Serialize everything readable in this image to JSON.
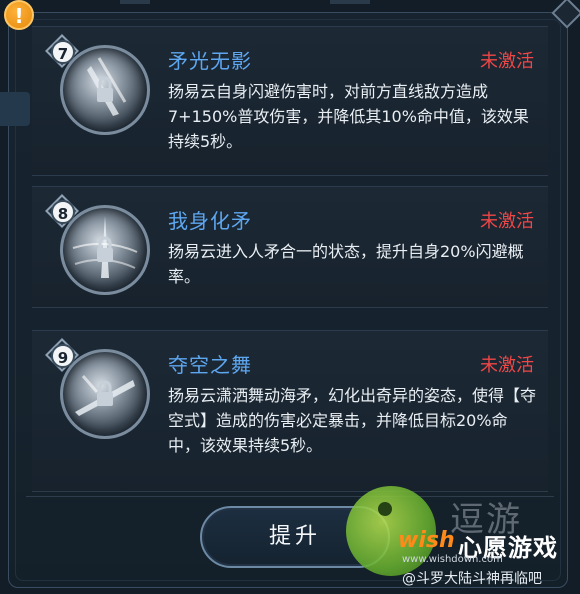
{
  "info_icon": "!",
  "skills": [
    {
      "number": "7",
      "title": "矛光无影",
      "status": "未激活",
      "description": "扬易云自身闪避伤害时，对前方直线敌方造成7+150%普攻伤害，并降低其10%命中值，该效果持续5秒。",
      "icon": "spear-lock-icon"
    },
    {
      "number": "8",
      "title": "我身化矛",
      "status": "未激活",
      "description": "扬易云进入人矛合一的状态，提升自身20%闪避概率。",
      "icon": "spear-lock-icon"
    },
    {
      "number": "9",
      "title": "夺空之舞",
      "status": "未激活",
      "description": "扬易云潇洒舞动海矛，幻化出奇异的姿态，使得【夺空式】造成的伤害必定暴击，并降低目标20%命中，该效果持续5秒。",
      "icon": "spear-lock-icon"
    }
  ],
  "upgrade_button": "提升",
  "watermark": {
    "gray_text": "逗游",
    "wish": "wish",
    "main": "心愿游戏",
    "url": "www.wishdown.com",
    "footer": "@斗罗大陆斗神再临吧"
  },
  "colors": {
    "title": "#5ea7f0",
    "status": "#f04646",
    "background": "#131d27"
  }
}
